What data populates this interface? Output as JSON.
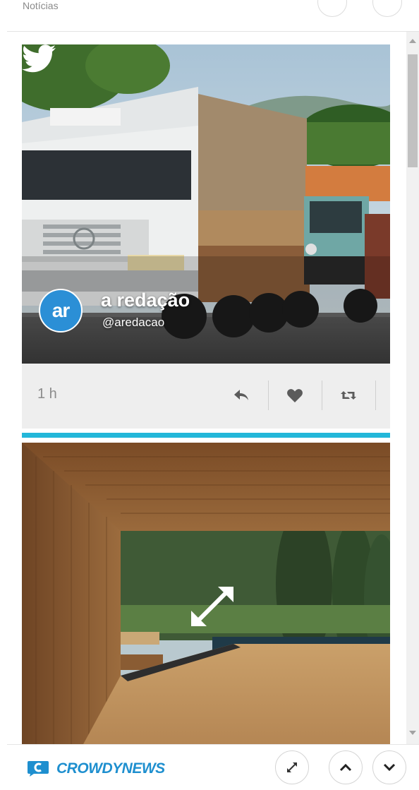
{
  "header": {
    "title": "Notícias"
  },
  "feed": {
    "posts": [
      {
        "author_name": "a redação",
        "author_handle": "@aredacao",
        "avatar_initials": "ar",
        "timestamp": "1 h",
        "source_icon": "twitter-icon"
      }
    ]
  },
  "footer": {
    "brand": "CROWDYNEWS"
  },
  "colors": {
    "accent": "#23b7d9",
    "brand": "#1e8fcf",
    "avatar": "#2b8fd6"
  }
}
